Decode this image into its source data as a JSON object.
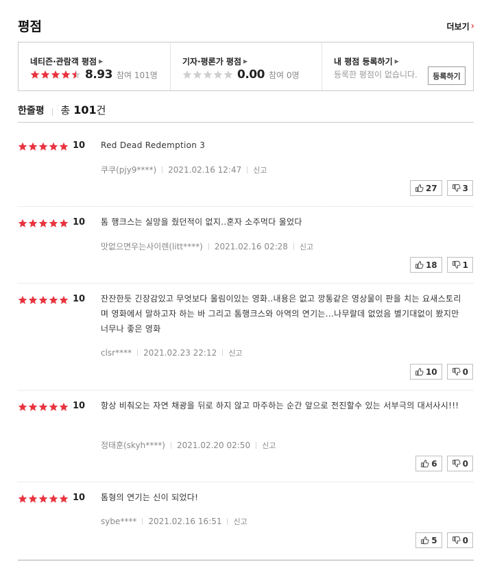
{
  "section": {
    "title": "평점",
    "more_label": "더보기"
  },
  "scores": {
    "netizen": {
      "label": "네티즌·관람객 평점",
      "score": "8.93",
      "count": "참여 101명",
      "stars": 4.5
    },
    "critic": {
      "label": "기자·평론가 평점",
      "score": "0.00",
      "count": "참여 0명",
      "stars": 0
    },
    "mine": {
      "label": "내 평점 등록하기",
      "empty_text": "등록한 평점이 없습니다.",
      "register_label": "등록하기"
    }
  },
  "comments": {
    "title": "한줄평",
    "total_prefix": "총",
    "total_count": "101",
    "total_suffix": "건",
    "items": [
      {
        "score": "10",
        "stars": 5,
        "text": "Red Dead Redemption 3",
        "author": "쿠쿠(pjy9****)",
        "date": "2021.02.16 12:47",
        "report": "신고",
        "likes": "27",
        "dislikes": "3"
      },
      {
        "score": "10",
        "stars": 5,
        "text": "톰 행크스는 실망을 줬던적이 없지..혼자 소주먹다 울었다",
        "author": "맛없으면우는사이렌(litt****)",
        "date": "2021.02.16 02:28",
        "report": "신고",
        "likes": "18",
        "dislikes": "1"
      },
      {
        "score": "10",
        "stars": 5,
        "text": "잔잔한듯 긴장감있고 무엇보다 울림이있는 영화..내용은 없고 깡통같은 영상물이 판을 치는 요새스토리며 영화에서 말하고자 하는 바 그리고 톰행크스와 아역의 연기는...나무랄데 없었음 별기대없이 봤지만 너무나 좋은 영화",
        "author": "clsr****",
        "date": "2021.02.23 22:12",
        "report": "신고",
        "likes": "10",
        "dislikes": "0"
      },
      {
        "score": "10",
        "stars": 5,
        "text": "항상 비춰오는 자연 채광을 뒤로 하지 않고 마주하는 순간 앞으로 전진할수 있는 서부극의 대서사시!!!",
        "author": "정태훈(skyh****)",
        "date": "2021.02.20 02:50",
        "report": "신고",
        "likes": "6",
        "dislikes": "0"
      },
      {
        "score": "10",
        "stars": 5,
        "text": "톰형의 연기는 신이 되었다!",
        "author": "sybe****",
        "date": "2021.02.16 16:51",
        "report": "신고",
        "likes": "5",
        "dislikes": "0"
      }
    ]
  },
  "colors": {
    "star_on": "#e8343f",
    "star_off": "#cfcfcf",
    "accent": "#e04545"
  }
}
